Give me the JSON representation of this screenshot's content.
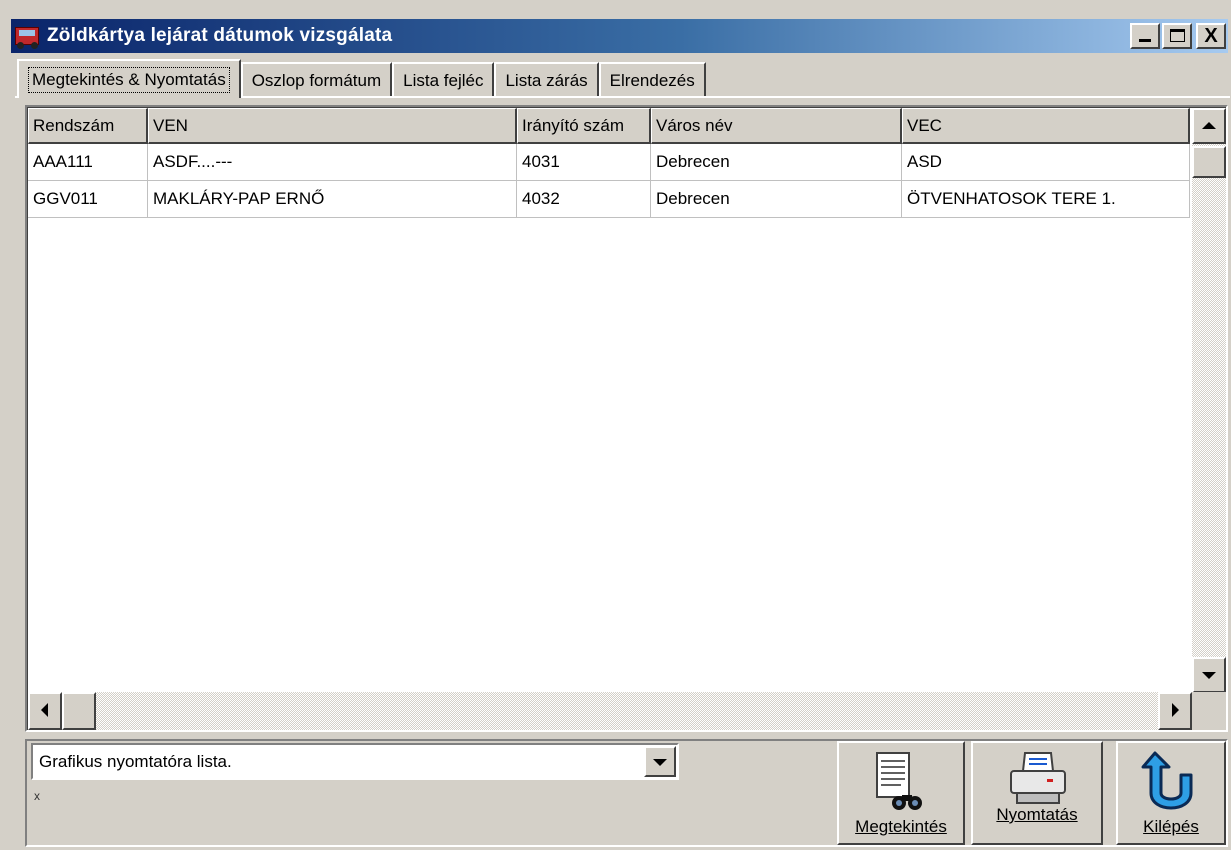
{
  "window": {
    "title": "Zöldkártya lejárat dátumok vizsgálata",
    "app_icon": "truck-icon",
    "controls": [
      "minimize-icon",
      "maximize-icon",
      "close-icon"
    ],
    "close_glyph": "X"
  },
  "tabs": [
    {
      "label": "Megtekintés & Nyomtatás",
      "active": true
    },
    {
      "label": "Oszlop formátum",
      "active": false
    },
    {
      "label": "Lista fejléc",
      "active": false
    },
    {
      "label": "Lista zárás",
      "active": false
    },
    {
      "label": "Elrendezés",
      "active": false
    }
  ],
  "grid": {
    "columns": [
      "Rendszám",
      "VEN",
      "Irányító szám",
      "Város név",
      "VEC"
    ],
    "rows": [
      [
        "AAA111",
        "ASDF....---",
        "4031",
        "Debrecen",
        "ASD"
      ],
      [
        "GGV011",
        "MAKLÁRY-PAP ERNŐ",
        "4032",
        "Debrecen",
        "ÖTVENHATOSOK TERE 1."
      ]
    ]
  },
  "output": {
    "selected": "Grafikus nyomtatóra lista.",
    "mark": "x"
  },
  "buttons": {
    "preview": {
      "label": "Megtekintés",
      "icon": "document-binoculars-icon"
    },
    "print": {
      "label": "Nyomtatás",
      "icon": "printer-icon"
    },
    "exit": {
      "label": "Kilépés",
      "icon": "exit-arrow-icon"
    }
  },
  "colors": {
    "titlebar_start": "#0a246a",
    "titlebar_end": "#a6caf0",
    "face": "#d4d0c8",
    "exit_arrow": "#2e9fe6"
  }
}
